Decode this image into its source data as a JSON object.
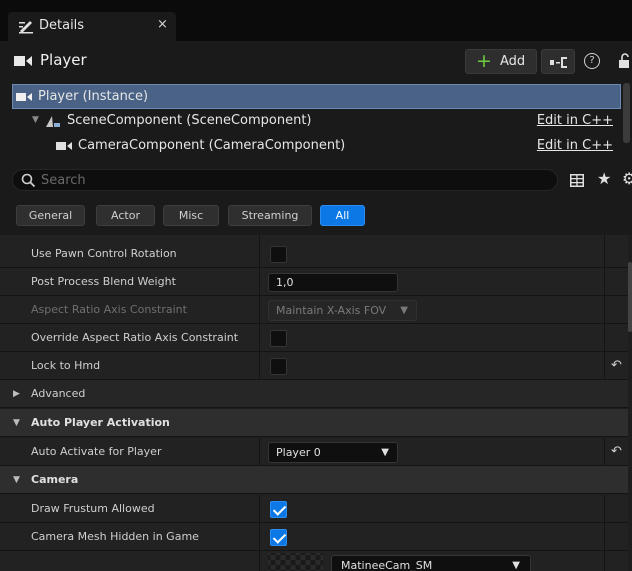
{
  "tab": {
    "title": "Details",
    "close": "×"
  },
  "header": {
    "actor_name": "Player",
    "add_label": "Add",
    "help": "?"
  },
  "tree": {
    "items": [
      {
        "label": "Player (Instance)",
        "link": ""
      },
      {
        "label": "SceneComponent (SceneComponent)",
        "link": "Edit in C++"
      },
      {
        "label": "CameraComponent (CameraComponent)",
        "link": "Edit in C++"
      }
    ]
  },
  "search": {
    "placeholder": "Search"
  },
  "filters": [
    {
      "label": "General",
      "active": false
    },
    {
      "label": "Actor",
      "active": false
    },
    {
      "label": "Misc",
      "active": false
    },
    {
      "label": "Streaming",
      "active": false
    },
    {
      "label": "All",
      "active": true
    }
  ],
  "properties": {
    "use_pawn_control_rotation": {
      "label": "Use Pawn Control Rotation",
      "checked": false
    },
    "post_process_blend_weight": {
      "label": "Post Process Blend Weight",
      "value": "1,0"
    },
    "aspect_ratio_axis_constraint": {
      "label": "Aspect Ratio Axis Constraint",
      "value": "Maintain X-Axis FOV"
    },
    "override_aspect_ratio": {
      "label": "Override Aspect Ratio Axis Constraint",
      "checked": false
    },
    "lock_to_hmd": {
      "label": "Lock to Hmd",
      "checked": false
    },
    "advanced": {
      "label": "Advanced"
    },
    "auto_player_activation": {
      "label": "Auto Player Activation"
    },
    "auto_activate_for_player": {
      "label": "Auto Activate for Player",
      "value": "Player 0"
    },
    "camera": {
      "label": "Camera"
    },
    "draw_frustum_allowed": {
      "label": "Draw Frustum Allowed",
      "checked": true
    },
    "camera_mesh_hidden": {
      "label": "Camera Mesh Hidden in Game",
      "checked": true
    },
    "camera_mesh": {
      "value": "MatineeCam_SM"
    }
  },
  "colors": {
    "accent": "#0b78e5",
    "selection": "#4a6285",
    "add_plus": "#6fcc3c"
  }
}
